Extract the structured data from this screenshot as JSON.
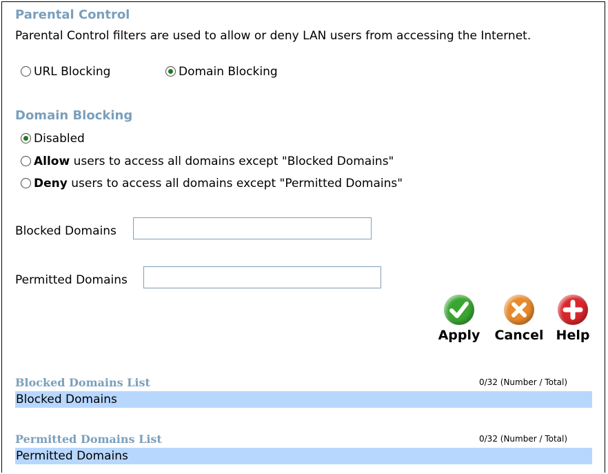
{
  "parental": {
    "title": "Parental Control",
    "description": "Parental Control filters are used to allow or deny LAN users from accessing the Internet.",
    "modes": [
      {
        "label": "URL Blocking",
        "checked": false
      },
      {
        "label": "Domain Blocking",
        "checked": true
      }
    ]
  },
  "domain_blocking": {
    "title": "Domain Blocking",
    "options": {
      "disabled": "Disabled",
      "allow_bold": "Allow",
      "allow_rest": " users to access all domains except \"Blocked Domains\"",
      "deny_bold": "Deny",
      "deny_rest": " users to access all domains except \"Permitted Domains\""
    },
    "selected": "disabled"
  },
  "fields": {
    "blocked_label": "Blocked Domains",
    "blocked_value": "",
    "permitted_label": "Permitted Domains",
    "permitted_value": ""
  },
  "buttons": {
    "apply": "Apply",
    "cancel": "Cancel",
    "help": "Help"
  },
  "lists": {
    "blocked": {
      "title": "Blocked Domains List",
      "count": "0/32 (Number / Total)",
      "header": "Blocked Domains"
    },
    "permitted": {
      "title": "Permitted Domains List",
      "count": "0/32 (Number / Total)",
      "header": "Permitted Domains"
    }
  },
  "colors": {
    "heading": "#7a9fbc",
    "list_bar": "#b7d7ff",
    "apply": "#3aa632",
    "cancel": "#e8892a",
    "help": "#d8262b"
  }
}
